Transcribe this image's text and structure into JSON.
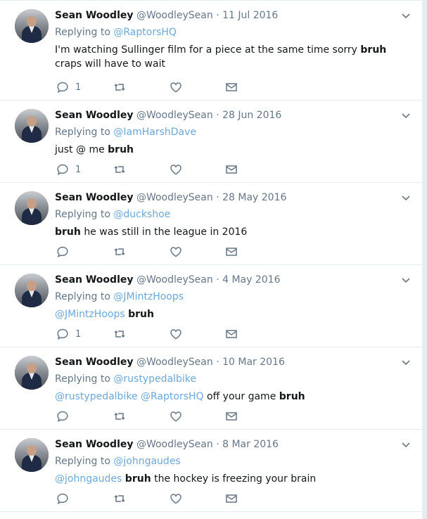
{
  "tweets": [
    {
      "name": "Sean Woodley",
      "handle": "@WoodleySean",
      "sep": "·",
      "date": "11 Jul 2016",
      "replying_label": "Replying to",
      "replying_to": "@RaptorsHQ",
      "text_pre": "I'm watching Sullinger film for a piece at the same time sorry",
      "text_bold": "bruh",
      "text_post": "craps will have to wait",
      "reply_count": "1"
    },
    {
      "name": "Sean Woodley",
      "handle": "@WoodleySean",
      "sep": "·",
      "date": "28 Jun 2016",
      "replying_label": "Replying to",
      "replying_to": "@IamHarshDave",
      "text_pre": "just @ me",
      "text_bold": "bruh",
      "text_post": "",
      "reply_count": "1"
    },
    {
      "name": "Sean Woodley",
      "handle": "@WoodleySean",
      "sep": "·",
      "date": "28 May 2016",
      "replying_label": "Replying to",
      "replying_to": "@duckshoe",
      "text_pre": "",
      "text_bold": "bruh",
      "text_post": "he was still in the league in 2016",
      "reply_count": ""
    },
    {
      "name": "Sean Woodley",
      "handle": "@WoodleySean",
      "sep": "·",
      "date": "4 May 2016",
      "replying_label": "Replying to",
      "replying_to": "@JMintzHoops",
      "mentions": "@JMintzHoops",
      "text_bold": "bruh",
      "text_post": "",
      "reply_count": "1"
    },
    {
      "name": "Sean Woodley",
      "handle": "@WoodleySean",
      "sep": "·",
      "date": "10 Mar 2016",
      "replying_label": "Replying to",
      "replying_to": "@rustypedalbike",
      "mentions": "@rustypedalbike @RaptorsHQ",
      "text_mid": "off your game",
      "text_bold": "bruh",
      "reply_count": ""
    },
    {
      "name": "Sean Woodley",
      "handle": "@WoodleySean",
      "sep": "·",
      "date": "8 Mar 2016",
      "replying_label": "Replying to",
      "replying_to": "@johngaudes",
      "mentions": "@johngaudes",
      "text_bold": "bruh",
      "text_post": "the hockey is freezing your brain",
      "reply_count": ""
    }
  ],
  "icons": {
    "reply": "reply-icon",
    "retweet": "retweet-icon",
    "like": "heart-icon",
    "dm": "envelope-icon",
    "caret": "chevron-down-icon"
  },
  "colors": {
    "link": "#6aa8d8",
    "meta": "#657786",
    "background": "#e6ecf0"
  }
}
